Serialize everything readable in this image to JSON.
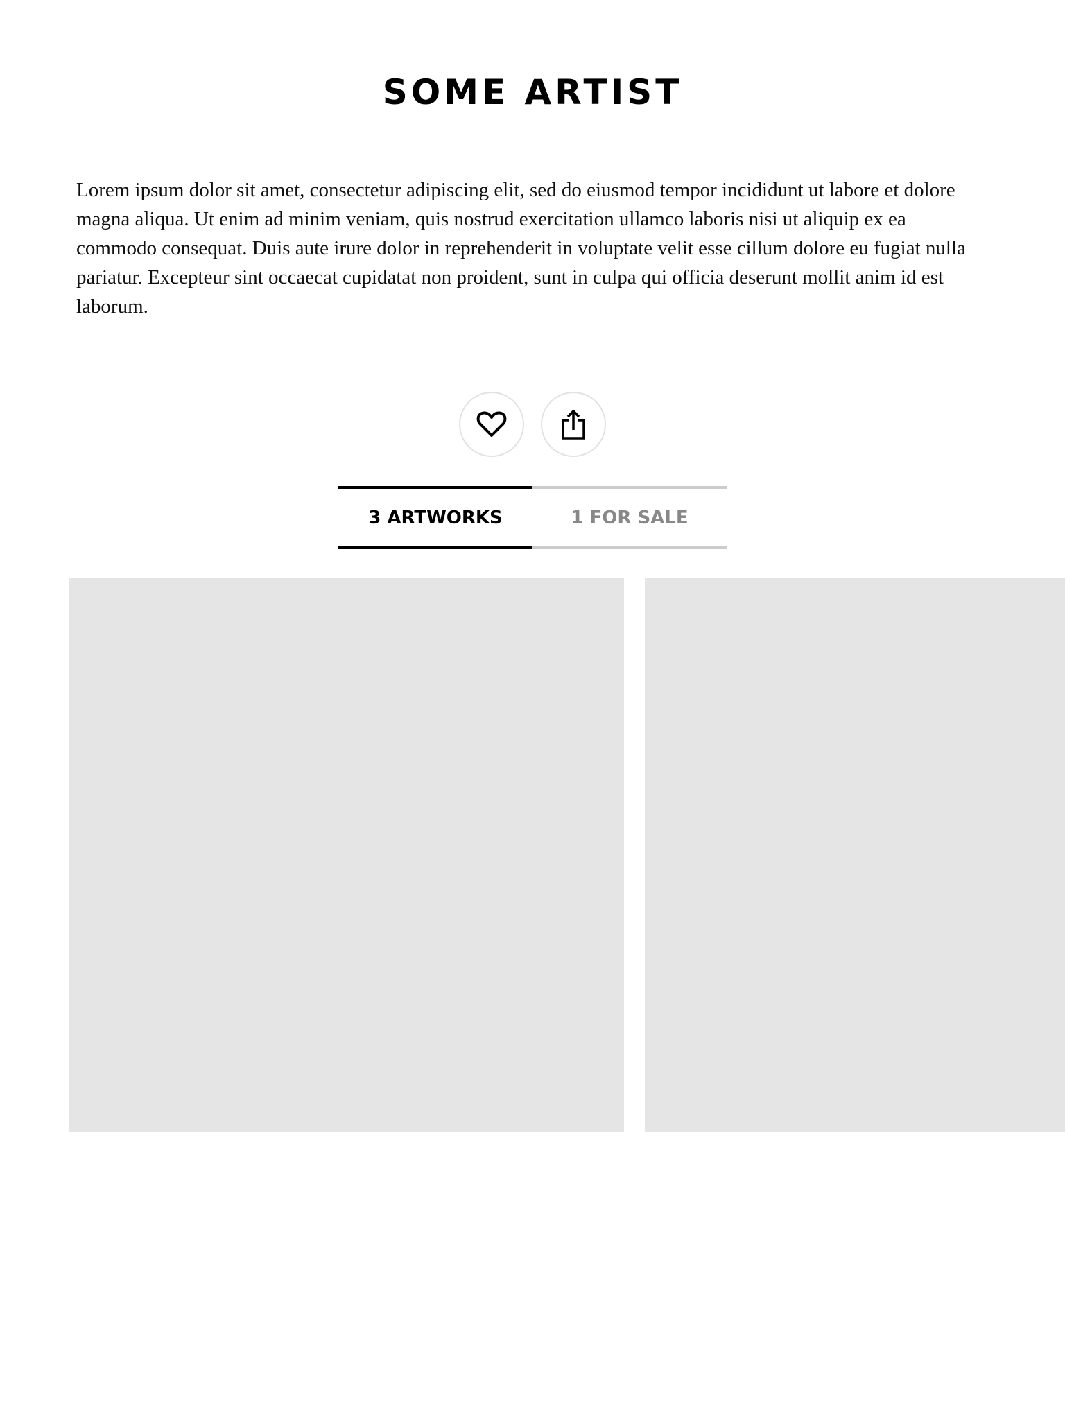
{
  "artist": {
    "name": "SOME ARTIST",
    "bio": "Lorem ipsum dolor sit amet, consectetur adipiscing elit, sed do eiusmod tempor incididunt ut labore et dolore magna aliqua. Ut enim ad minim veniam, quis nostrud exercitation ullamco laboris nisi ut aliquip ex ea commodo consequat. Duis aute irure dolor in reprehenderit in voluptate velit esse cillum dolore eu fugiat nulla pariatur. Excepteur sint occaecat cupidatat non proident, sunt in culpa qui officia deserunt mollit anim id est laborum."
  },
  "actions": {
    "favorite_icon": "heart-icon",
    "share_icon": "share-icon"
  },
  "tabs": [
    {
      "label": "3 ARTWORKS",
      "active": true
    },
    {
      "label": "1 FOR SALE",
      "active": false
    }
  ],
  "colors": {
    "active_tab": "#000000",
    "inactive_tab_text": "#888888",
    "inactive_tab_border": "#cccccc",
    "placeholder": "#e5e5e5",
    "button_border": "#e2e2e2"
  }
}
